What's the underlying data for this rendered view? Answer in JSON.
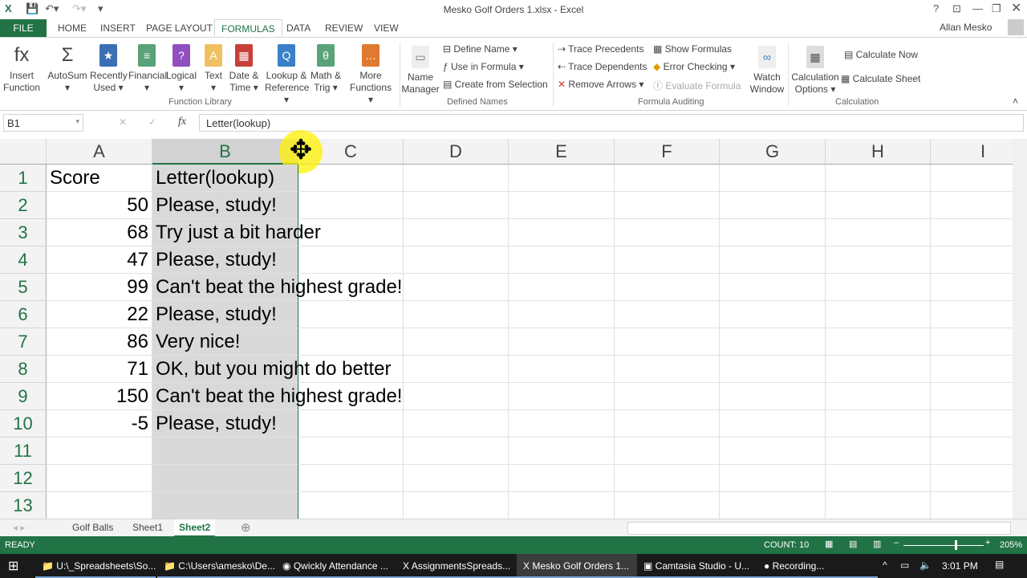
{
  "window": {
    "title": "Mesko Golf Orders 1.xlsx - Excel",
    "user": "Allan Mesko"
  },
  "tabs": [
    "FILE",
    "HOME",
    "INSERT",
    "PAGE LAYOUT",
    "FORMULAS",
    "DATA",
    "REVIEW",
    "VIEW"
  ],
  "active_tab": "FORMULAS",
  "ribbon": {
    "function_library": {
      "label": "Function Library",
      "buttons": [
        {
          "l1": "Insert",
          "l2": "Function",
          "icon": "fx",
          "color": "#ffffff"
        },
        {
          "l1": "AutoSum",
          "l2": "▾",
          "icon": "Σ",
          "color": "#ffffff"
        },
        {
          "l1": "Recently",
          "l2": "Used ▾",
          "icon": "★",
          "color": "#3a6fb5"
        },
        {
          "l1": "Financial",
          "l2": "▾",
          "icon": "≡",
          "color": "#5aa37a"
        },
        {
          "l1": "Logical",
          "l2": "▾",
          "icon": "?",
          "color": "#8f4fbf"
        },
        {
          "l1": "Text",
          "l2": "▾",
          "icon": "A",
          "color": "#f0c060"
        },
        {
          "l1": "Date &",
          "l2": "Time ▾",
          "icon": "▦",
          "color": "#c8403a"
        },
        {
          "l1": "Lookup &",
          "l2": "Reference ▾",
          "icon": "Q",
          "color": "#3a7fc8"
        },
        {
          "l1": "Math &",
          "l2": "Trig ▾",
          "icon": "θ",
          "color": "#5aa37a"
        },
        {
          "l1": "More",
          "l2": "Functions ▾",
          "icon": "…",
          "color": "#e07a30"
        }
      ]
    },
    "defined_names": {
      "label": "Defined Names",
      "name_manager": [
        "Name",
        "Manager"
      ],
      "items": [
        "Define Name ▾",
        "Use in Formula ▾",
        "Create from Selection"
      ]
    },
    "formula_auditing": {
      "label": "Formula Auditing",
      "items": [
        "Trace Precedents",
        "Trace Dependents",
        "Remove Arrows ▾",
        "Show Formulas",
        "Error Checking ▾",
        "Evaluate Formula"
      ],
      "watch": [
        "Watch",
        "Window"
      ]
    },
    "calculation": {
      "label": "Calculation",
      "options": [
        "Calculation",
        "Options ▾"
      ],
      "items": [
        "Calculate Now",
        "Calculate Sheet"
      ]
    }
  },
  "formula_bar": {
    "name_box": "B1",
    "formula": "Letter(lookup)"
  },
  "grid": {
    "columns": [
      "A",
      "B",
      "C",
      "D",
      "E",
      "F",
      "G",
      "H",
      "I"
    ],
    "selected_column": "B",
    "rows": [
      {
        "n": "1",
        "a": "Score",
        "b": "Letter(lookup)"
      },
      {
        "n": "2",
        "a": "50",
        "b": "Please, study!"
      },
      {
        "n": "3",
        "a": "68",
        "b": "Try just a bit harder"
      },
      {
        "n": "4",
        "a": "47",
        "b": "Please, study!"
      },
      {
        "n": "5",
        "a": "99",
        "b": "Can't beat the highest grade!"
      },
      {
        "n": "6",
        "a": "22",
        "b": "Please, study!"
      },
      {
        "n": "7",
        "a": "86",
        "b": "Very nice!"
      },
      {
        "n": "8",
        "a": "71",
        "b": "OK, but you might do better"
      },
      {
        "n": "9",
        "a": "150",
        "b": "Can't beat the highest grade!"
      },
      {
        "n": "10",
        "a": "-5",
        "b": "Please, study!"
      },
      {
        "n": "11",
        "a": "",
        "b": ""
      },
      {
        "n": "12",
        "a": "",
        "b": ""
      },
      {
        "n": "13",
        "a": "",
        "b": ""
      }
    ]
  },
  "sheets": [
    "Golf Balls",
    "Sheet1",
    "Sheet2"
  ],
  "active_sheet": "Sheet2",
  "status": {
    "mode": "READY",
    "count": "COUNT: 10",
    "zoom": "205%"
  },
  "taskbar": {
    "items": [
      "U:\\_Spreadsheets\\So...",
      "C:\\Users\\amesko\\De...",
      "Qwickly Attendance ...",
      "AssignmentsSpreads...",
      "Mesko Golf Orders 1...",
      "Camtasia Studio - U...",
      "Recording..."
    ],
    "active": "Mesko Golf Orders 1...",
    "clock": "3:01 PM"
  }
}
